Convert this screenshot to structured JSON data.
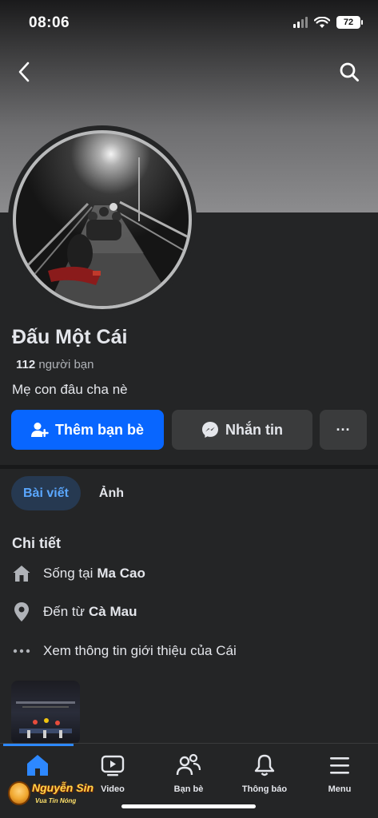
{
  "status_bar": {
    "time": "08:06",
    "battery": "72"
  },
  "profile": {
    "name": "Đấu Một Cái",
    "friends_count": "112",
    "friends_label": "người bạn",
    "bio": "Mẹ con đâu cha nè"
  },
  "actions": {
    "add_friend": "Thêm bạn bè",
    "message": "Nhắn tin",
    "more": "···"
  },
  "tabs": [
    {
      "label": "Bài viết",
      "active": true
    },
    {
      "label": "Ảnh",
      "active": false
    }
  ],
  "details": {
    "title": "Chi tiết",
    "lives_prefix": "Sống tại",
    "lives_value": "Ma Cao",
    "from_prefix": "Đến từ",
    "from_value": "Cà Mau",
    "see_more": "Xem thông tin giới thiệu của Cái"
  },
  "bottom_nav": [
    {
      "label": "",
      "icon": "home-icon",
      "active": true
    },
    {
      "label": "Video",
      "icon": "video-icon",
      "active": false
    },
    {
      "label": "Bạn bè",
      "icon": "friends-icon",
      "active": false
    },
    {
      "label": "Thông báo",
      "icon": "bell-icon",
      "active": false
    },
    {
      "label": "Menu",
      "icon": "menu-icon",
      "active": false
    }
  ],
  "watermark": {
    "name": "Nguyễn Sin",
    "tagline": "Vua Tin Nóng"
  },
  "colors": {
    "accent": "#0866ff",
    "tab_active_bg": "#263951",
    "tab_active_text": "#5aa7ff",
    "background": "#242526"
  }
}
